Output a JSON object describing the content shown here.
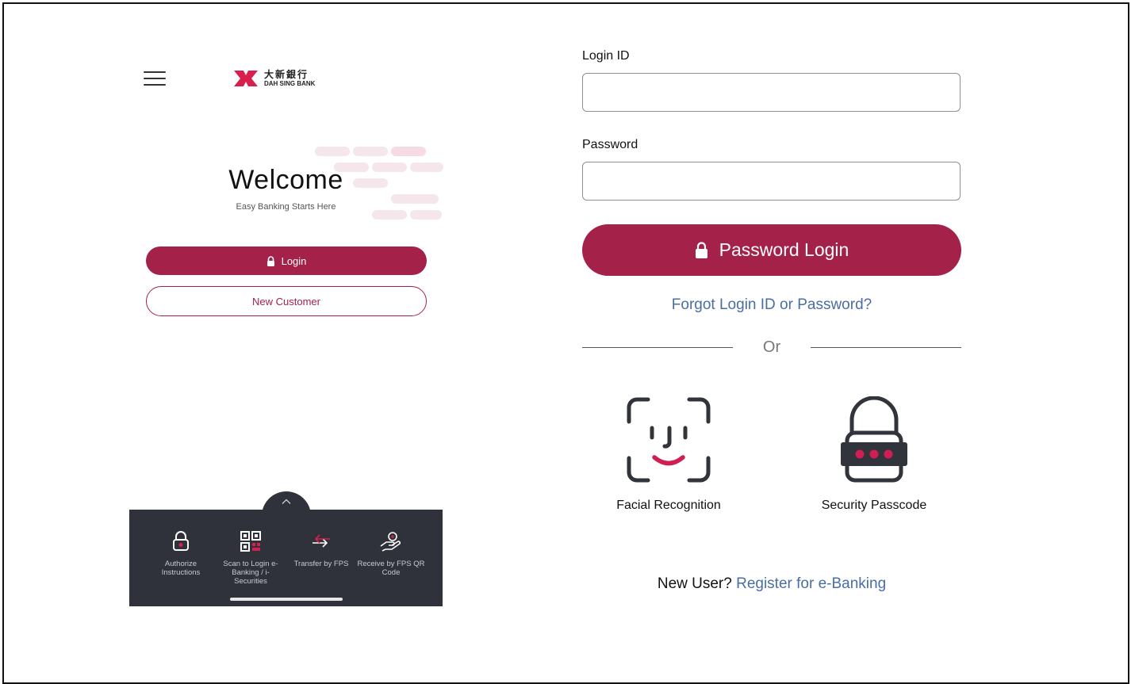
{
  "colors": {
    "brand": "#a4214a",
    "link": "#4a6ea3",
    "tray": "#2f313b"
  },
  "left_screen": {
    "logo": {
      "chinese": "大新銀行",
      "english": "DAH SING BANK"
    },
    "welcome_title": "Welcome",
    "welcome_subtitle": "Easy Banking Starts Here",
    "login_button": "Login",
    "new_customer_button": "New Customer",
    "quick_actions": [
      {
        "icon": "lock-icon",
        "label": "Authorize Instructions"
      },
      {
        "icon": "qr-code-icon",
        "label": "Scan to Login e-Banking / i-Securities"
      },
      {
        "icon": "transfer-arrows-icon",
        "label": "Transfer by FPS"
      },
      {
        "icon": "hand-receive-icon",
        "label": "Receive by FPS QR Code"
      }
    ]
  },
  "login_form": {
    "login_id_label": "Login ID",
    "login_id_value": "",
    "password_label": "Password",
    "password_value": "",
    "password_login_button": "Password Login",
    "forgot_link": "Forgot Login ID or Password?",
    "or_text": "Or",
    "facial_recognition_label": "Facial Recognition",
    "security_passcode_label": "Security Passcode",
    "new_user_prefix": "New User?",
    "register_link": "Register for e-Banking"
  }
}
